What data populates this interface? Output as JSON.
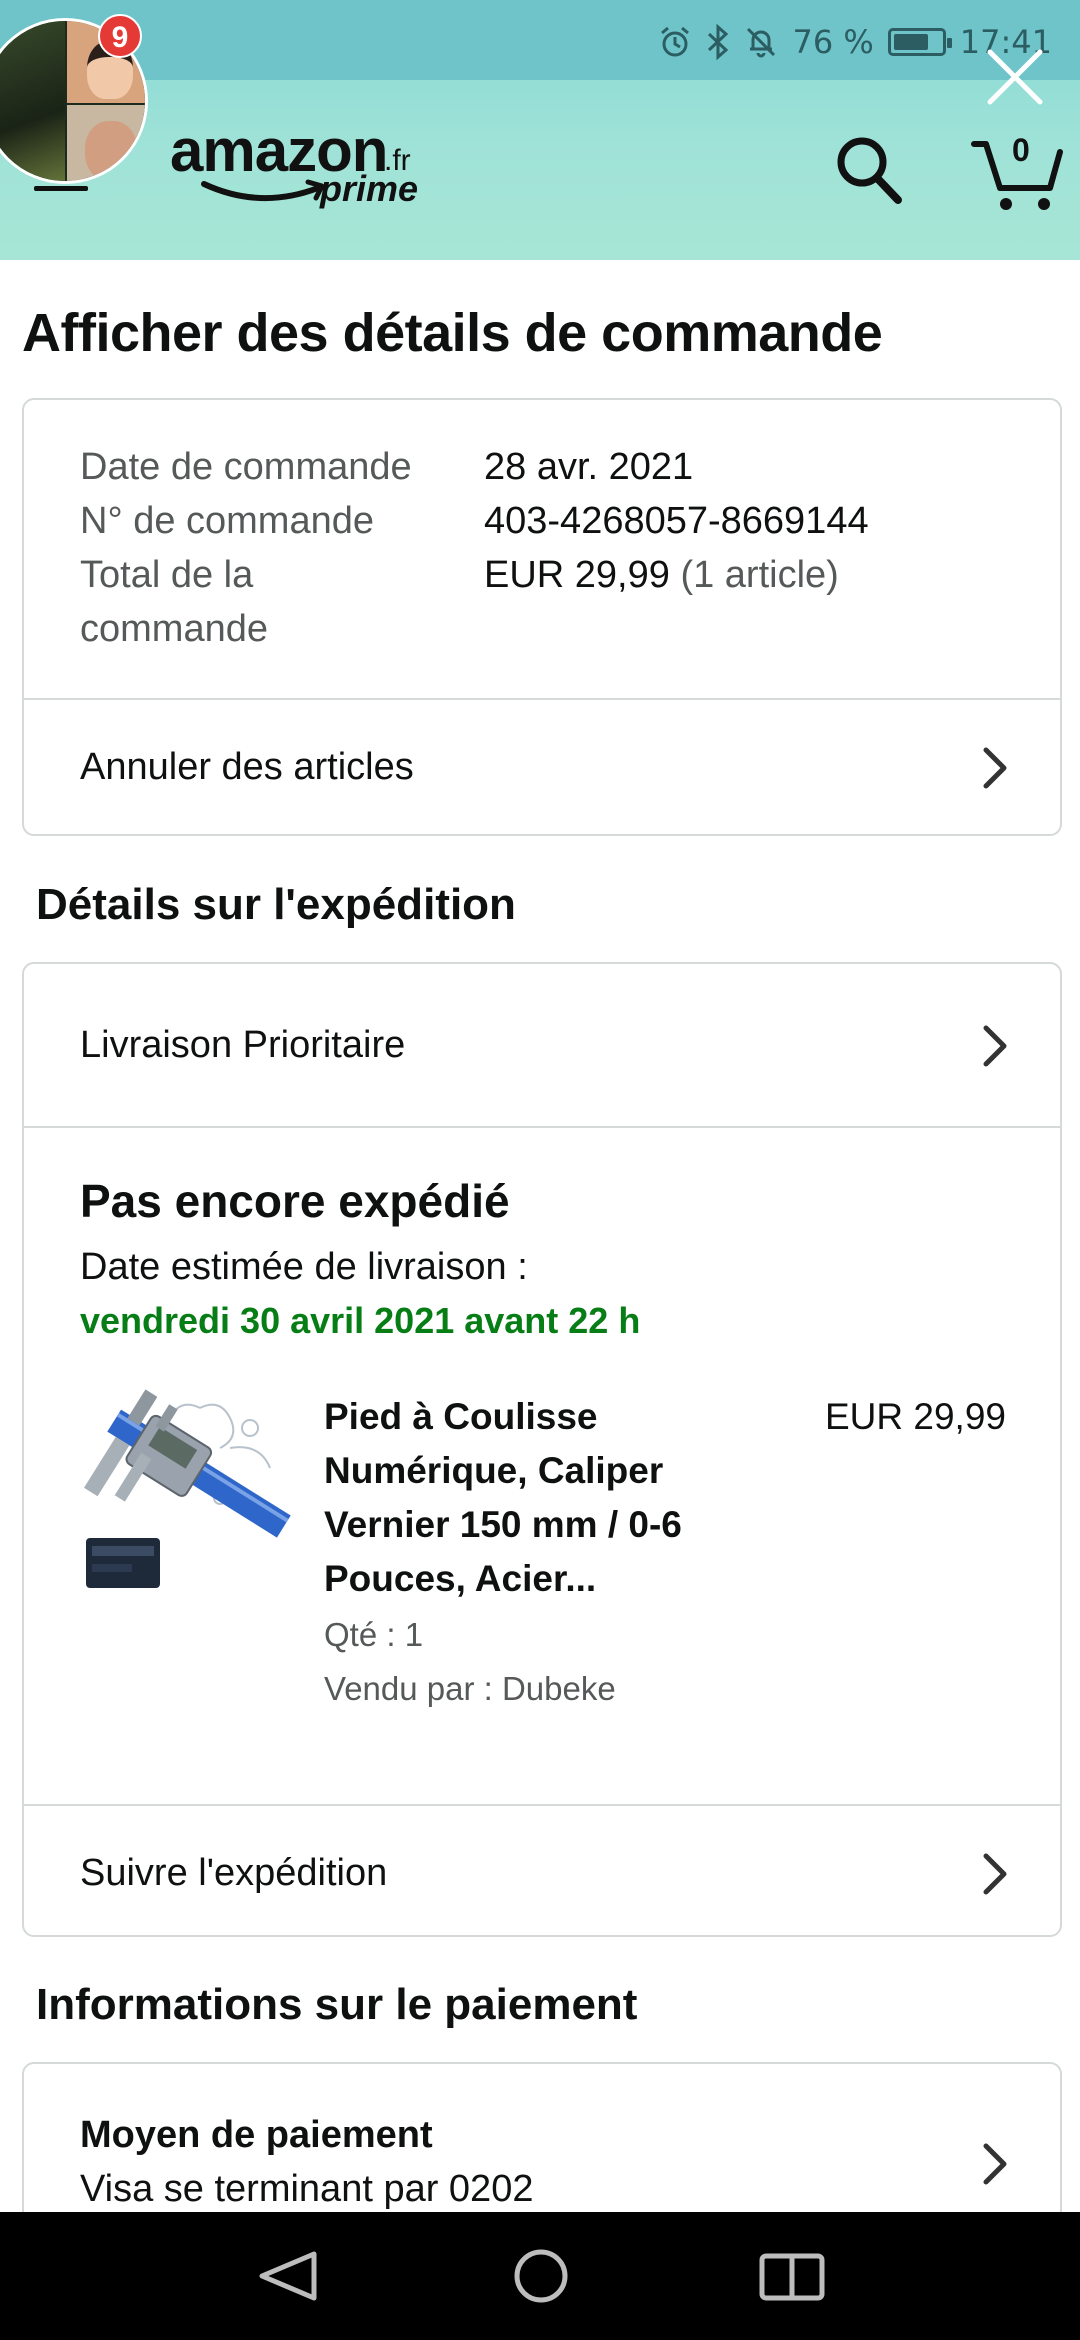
{
  "status_bar": {
    "battery": "76 %",
    "time": "17:41"
  },
  "chat_head": {
    "badge_count": "9"
  },
  "app_bar": {
    "logo_word": "amazon",
    "logo_tld": ".fr",
    "logo_sub": "prime",
    "cart_count": "0"
  },
  "page": {
    "title": "Afficher des détails de commande"
  },
  "order_summary": {
    "date_label": "Date de commande",
    "date_value": "28 avr. 2021",
    "number_label": "N° de commande",
    "number_value": "403-4268057-8669144",
    "total_label_line1": "Total de la",
    "total_label_line2": "commande",
    "total_value": "EUR 29,99",
    "total_items": "(1 article)",
    "cancel_label": "Annuler des articles"
  },
  "shipping": {
    "section_title": "Détails sur l'expédition",
    "method": "Livraison Prioritaire",
    "status": "Pas encore expédié",
    "estimate_label": "Date estimée de livraison :",
    "estimate_date": "vendredi 30 avril 2021 avant 22 h",
    "product": {
      "title_lines": [
        "Pied à Coulisse",
        "Numérique, Caliper",
        "Vernier 150 mm / 0-6",
        "Pouces, Acier..."
      ],
      "price": "EUR 29,99",
      "qty": "Qté : 1",
      "seller": "Vendu par : Dubeke"
    },
    "track_label": "Suivre l'expédition"
  },
  "payment": {
    "section_title": "Informations sur le paiement",
    "method_label": "Moyen de paiement",
    "method_value": "Visa se terminant par 0202"
  },
  "colors": {
    "header_gradient_top": "#84d8d6",
    "header_gradient_bottom": "#a7e6d6",
    "delivery_green": "#067d15",
    "notification_red": "#e53935"
  }
}
